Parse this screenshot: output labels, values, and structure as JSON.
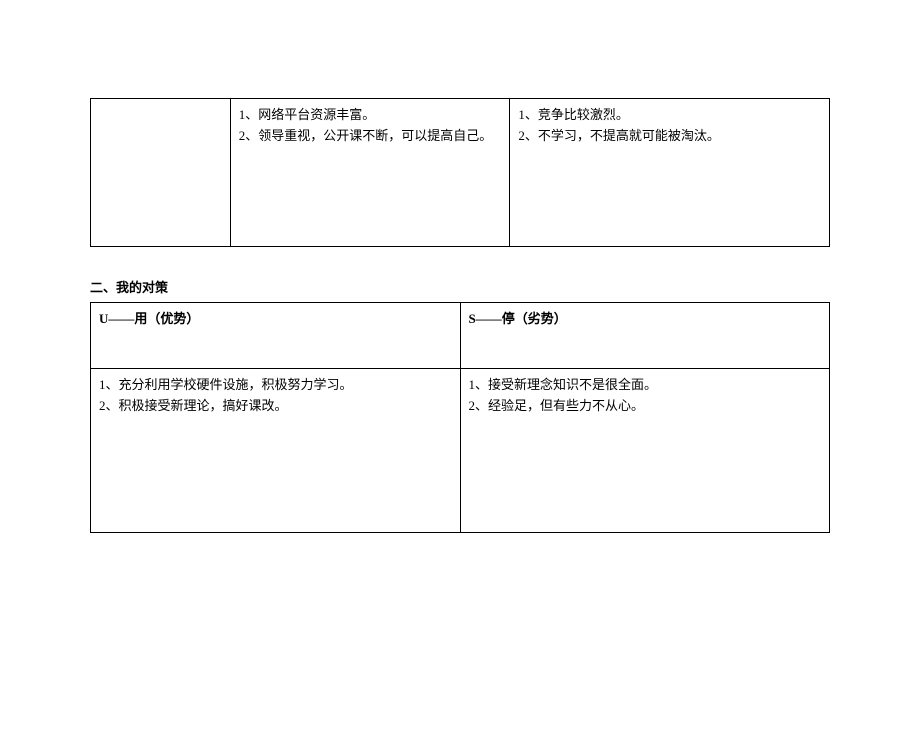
{
  "table1": {
    "col2": {
      "line1": "1、网络平台资源丰富。",
      "line2": "2、领导重视，公开课不断，可以提高自己。"
    },
    "col3": {
      "line1": "1、竞争比较激烈。",
      "line2": "2、不学习，不提高就可能被淘汰。"
    }
  },
  "section_title": "二、我的对策",
  "table2": {
    "header_left": "U——用（优势）",
    "header_right": "S——停（劣势）",
    "body_left": {
      "line1": "1、充分利用学校硬件设施，积极努力学习。",
      "line2": "2、积极接受新理论，搞好课改。"
    },
    "body_right": {
      "line1": "1、接受新理念知识不是很全面。",
      "line2": "2、经验足，但有些力不从心。"
    }
  }
}
